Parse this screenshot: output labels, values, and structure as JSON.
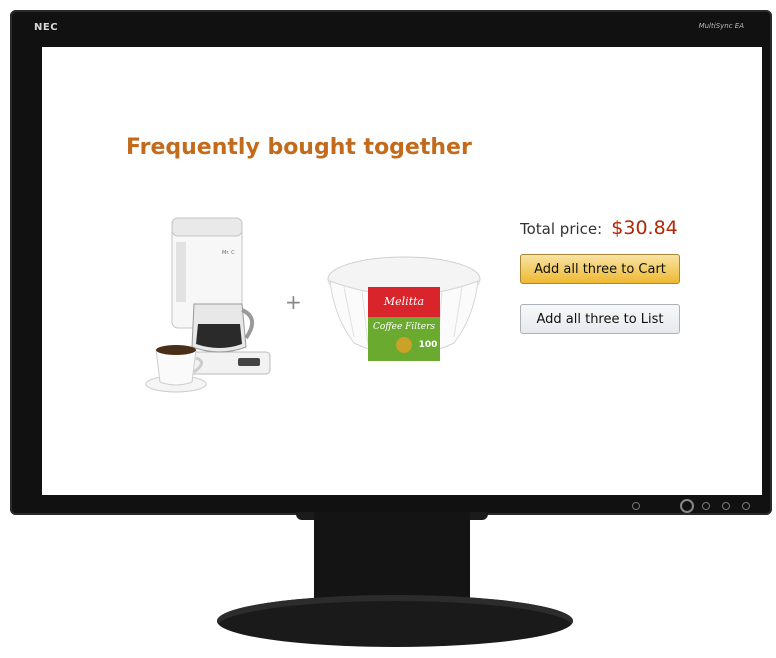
{
  "monitor": {
    "brand": "NEC",
    "model": "MultiSync EA"
  },
  "page": {
    "heading": "Frequently bought together",
    "plus_sign": "+",
    "total_label": "Total price:",
    "total_value": "$30.84",
    "add_cart_label": "Add all three to Cart",
    "add_list_label": "Add all three to List"
  },
  "products": {
    "coffee_maker": {
      "brand_text": "Mr. COFFEE"
    },
    "filters": {
      "brand_text": "Melitta",
      "product_text": "Coffee Filters",
      "count_text": "100"
    }
  },
  "colors": {
    "heading": "#c26b1c",
    "price": "#b12704",
    "cart_button": "#f0c14b",
    "list_button": "#e7e9ec"
  }
}
